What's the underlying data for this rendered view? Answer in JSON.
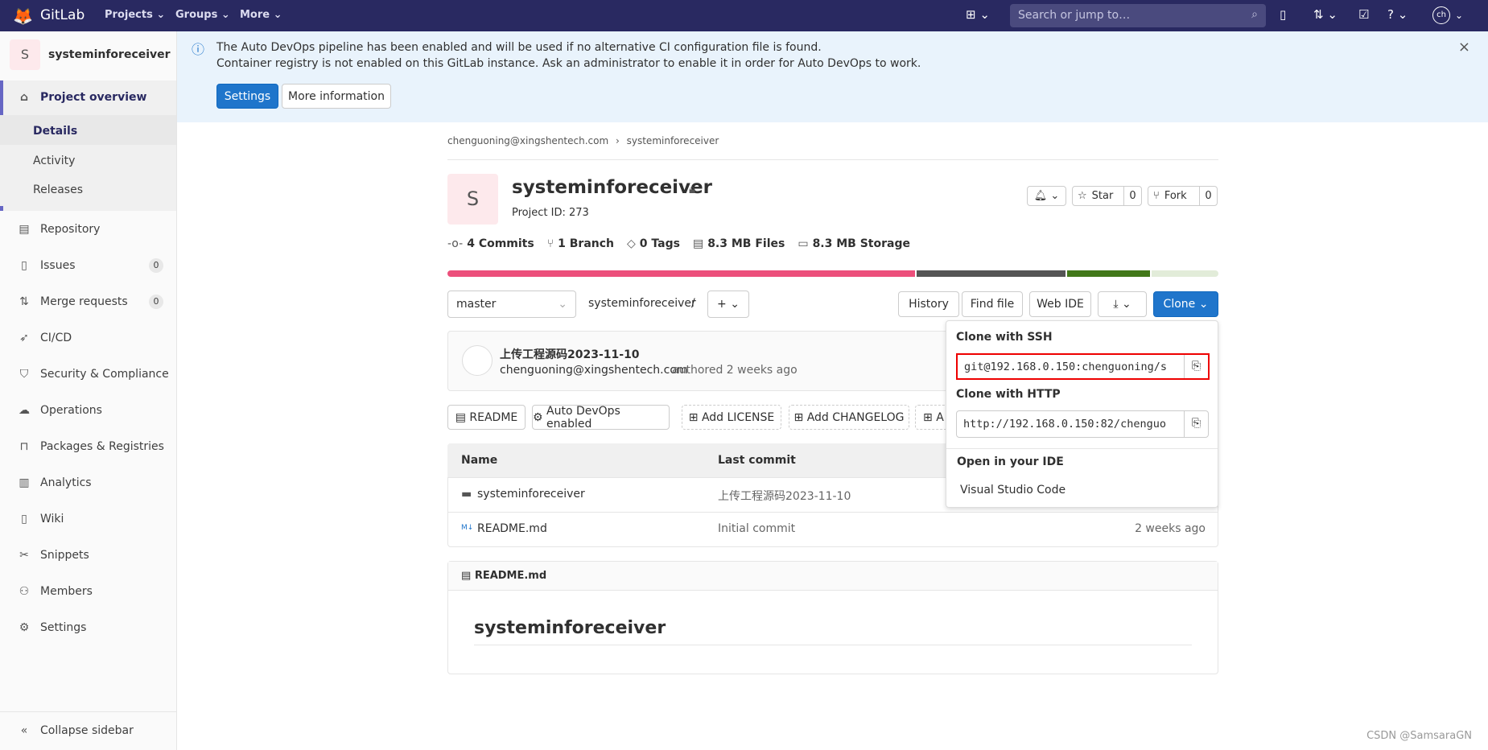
{
  "nav": {
    "brand": "GitLab",
    "links": [
      "Projects",
      "Groups",
      "More"
    ],
    "search_placeholder": "Search or jump to…",
    "avatar": "ch"
  },
  "sidebar": {
    "project_initial": "S",
    "project_name": "systeminforeceiver",
    "overview": "Project overview",
    "sub": [
      "Details",
      "Activity",
      "Releases"
    ],
    "items": [
      {
        "label": "Repository",
        "icon": "file-icon"
      },
      {
        "label": "Issues",
        "icon": "issues-icon",
        "count": "0"
      },
      {
        "label": "Merge requests",
        "icon": "merge-request-icon",
        "count": "0"
      },
      {
        "label": "CI/CD",
        "icon": "rocket-icon"
      },
      {
        "label": "Security & Compliance",
        "icon": "shield-icon"
      },
      {
        "label": "Operations",
        "icon": "cloud-icon"
      },
      {
        "label": "Packages & Registries",
        "icon": "package-icon"
      },
      {
        "label": "Analytics",
        "icon": "chart-icon"
      },
      {
        "label": "Wiki",
        "icon": "book-icon"
      },
      {
        "label": "Snippets",
        "icon": "scissors-icon"
      },
      {
        "label": "Members",
        "icon": "users-icon"
      },
      {
        "label": "Settings",
        "icon": "gear-icon"
      }
    ],
    "collapse": "Collapse sidebar"
  },
  "banner": {
    "line1": "The Auto DevOps pipeline has been enabled and will be used if no alternative CI configuration file is found.",
    "line2": "Container registry is not enabled on this GitLab instance. Ask an administrator to enable it in order for Auto DevOps to work.",
    "settings": "Settings",
    "more_info": "More information"
  },
  "breadcrumb": [
    "chenguoning@xingshentech.com",
    "systeminforeceiver"
  ],
  "project": {
    "initial": "S",
    "name": "systeminforeceiver",
    "id_label": "Project ID: 273",
    "star": "Star",
    "star_count": "0",
    "fork": "Fork",
    "fork_count": "0"
  },
  "stats": [
    "4 Commits",
    "1 Branch",
    "0 Tags",
    "8.3 MB Files",
    "8.3 MB Storage"
  ],
  "languages": [
    {
      "pct": 61,
      "color": "#ec4f7b"
    },
    {
      "pct": 19.5,
      "color": "#555555"
    },
    {
      "pct": 10.8,
      "color": "#427819"
    },
    {
      "pct": 8.7,
      "color": "#e2ecd9"
    }
  ],
  "toolbar": {
    "branch": "master",
    "path": "systeminforeceiver",
    "sep": "/",
    "history": "History",
    "find_file": "Find file",
    "web_ide": "Web IDE",
    "clone": "Clone"
  },
  "commit": {
    "title": "上传工程源码2023-11-10",
    "author": "chenguoning@xingshentech.com",
    "authored": "authored 2 weeks ago"
  },
  "quick": [
    "README",
    "Auto DevOps enabled",
    "Add LICENSE",
    "Add CHANGELOG",
    "A"
  ],
  "table": {
    "headers": [
      "Name",
      "Last commit"
    ],
    "rows": [
      {
        "name": "systeminforeceiver",
        "commit": "上传工程源码2023-11-10",
        "time": ""
      },
      {
        "name": "README.md",
        "commit": "Initial commit",
        "time": "2 weeks ago"
      }
    ]
  },
  "readme": {
    "file": "README.md",
    "heading": "systeminforeceiver"
  },
  "clone": {
    "ssh_label": "Clone with SSH",
    "ssh_url": "git@192.168.0.150:chenguoning/s",
    "http_label": "Clone with HTTP",
    "http_url": "http://192.168.0.150:82/chenguo",
    "ide_label": "Open in your IDE",
    "ide_item": "Visual Studio Code"
  },
  "watermark": "CSDN @SamsaraGN"
}
